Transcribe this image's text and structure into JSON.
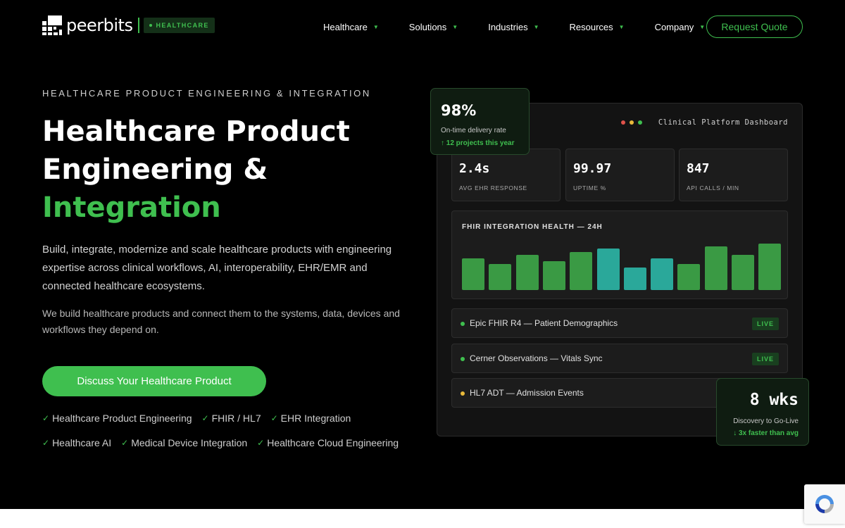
{
  "header": {
    "brand": "peerbits",
    "badge": "HEALTHCARE",
    "nav": [
      {
        "label": "Healthcare"
      },
      {
        "label": "Solutions"
      },
      {
        "label": "Industries"
      },
      {
        "label": "Resources"
      },
      {
        "label": "Company"
      }
    ],
    "quote_label": "Request Quote"
  },
  "hero": {
    "eyebrow": "HEALTHCARE PRODUCT ENGINEERING & INTEGRATION",
    "title_line1": "Healthcare Product",
    "title_line2": "Engineering &",
    "title_accent": "Integration",
    "lead": "Build, integrate, modernize and scale healthcare products with engineering expertise across clinical workflows, AI, interoperability, EHR/EMR and connected healthcare ecosystems.",
    "sub": "We build healthcare products and connect them to the systems, data, devices and workflows they depend on.",
    "cta": "Discuss Your Healthcare Product",
    "chips": [
      "Healthcare Product Engineering",
      "FHIR / HL7",
      "EHR Integration",
      "Healthcare AI",
      "Medical Device Integration",
      "Healthcare Cloud Engineering"
    ]
  },
  "dashboard": {
    "title": "Clinical Platform Dashboard",
    "window_dot_colors": [
      "#e0524a",
      "#e8b93a",
      "#3fbf4f"
    ],
    "stats": [
      {
        "value": "2.4s",
        "label": "AVG EHR RESPONSE"
      },
      {
        "value": "99.97",
        "label": "UPTIME %"
      },
      {
        "value": "847",
        "label": "API CALLS / MIN"
      }
    ],
    "health_title": "FHIR INTEGRATION HEALTH — 24H",
    "feeds": [
      {
        "text": "Epic FHIR R4 — Patient Demographics",
        "status": "LIVE",
        "dot_color": "#3fbf4f"
      },
      {
        "text": "Cerner Observations — Vitals Sync",
        "status": "LIVE",
        "dot_color": "#3fbf4f"
      },
      {
        "text": "HL7 ADT — Admission Events",
        "status": "",
        "dot_color": "#e8b93a"
      }
    ]
  },
  "float_delivery": {
    "value": "98%",
    "caption": "On-time delivery rate",
    "trend": "↑ 12 projects this year"
  },
  "float_golive": {
    "value": "8 wks",
    "caption": "Discovery to Go-Live",
    "trend": "↓ 3x faster than avg"
  },
  "colors": {
    "accent": "#3fbf4f",
    "teal": "#2aa89a",
    "bar_green": "#3a9a44",
    "background": "#000000"
  },
  "chart_data": {
    "type": "bar",
    "values": [
      36,
      30,
      40,
      33,
      43,
      47,
      26,
      36,
      30,
      50,
      40,
      53
    ],
    "highlight": [
      false,
      false,
      false,
      false,
      false,
      true,
      true,
      true,
      false,
      false,
      false,
      false
    ],
    "ylim": [
      0,
      56
    ]
  }
}
